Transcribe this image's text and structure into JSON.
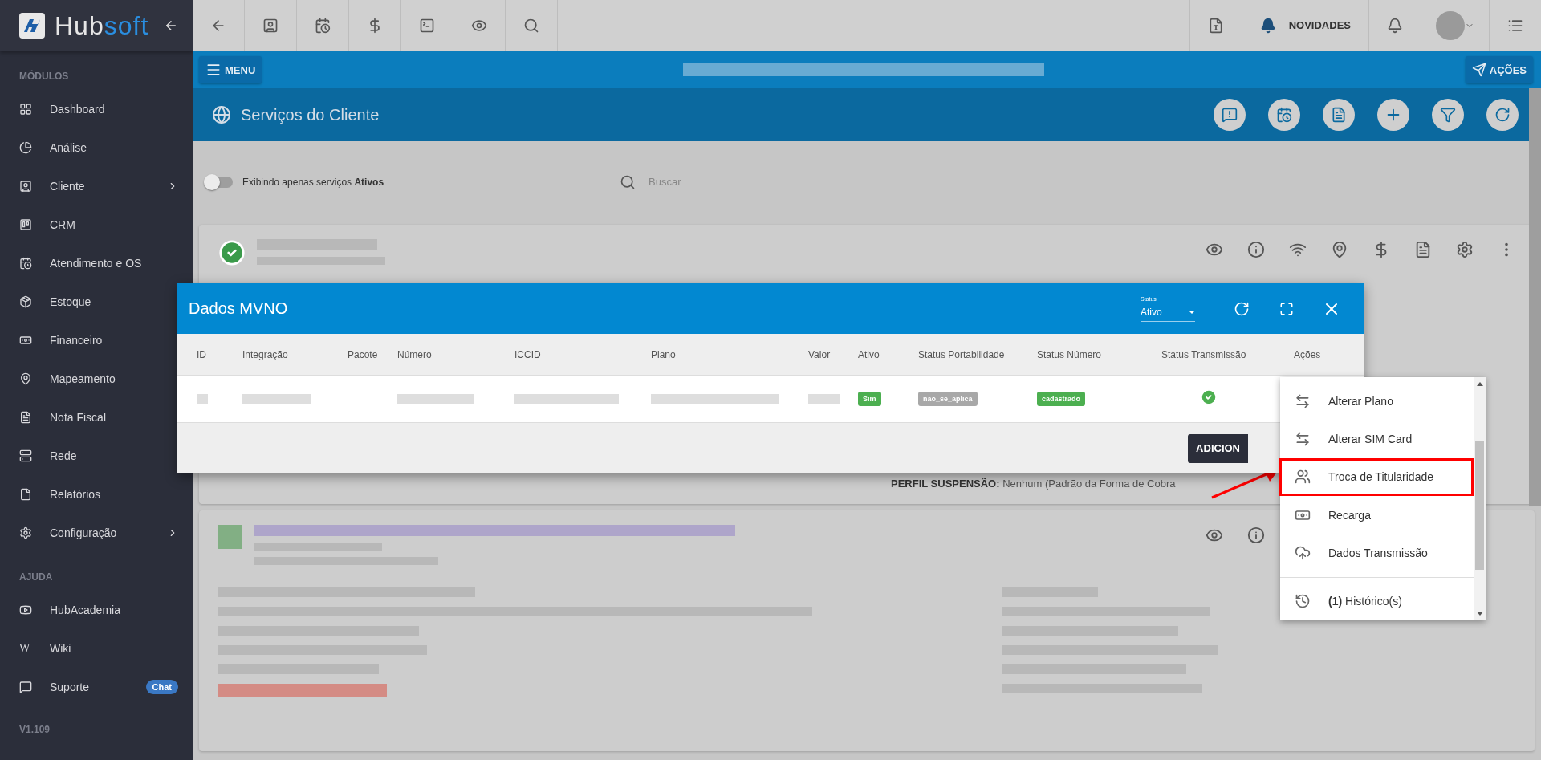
{
  "sidebar": {
    "logo": {
      "first": "Hub",
      "second": "soft"
    },
    "sections": [
      {
        "title": "MÓDULOS",
        "items": [
          {
            "label": "Dashboard",
            "submenu": false
          },
          {
            "label": "Análise",
            "submenu": false
          },
          {
            "label": "Cliente",
            "submenu": true
          },
          {
            "label": "CRM",
            "submenu": false
          },
          {
            "label": "Atendimento e OS",
            "submenu": false
          },
          {
            "label": "Estoque",
            "submenu": false
          },
          {
            "label": "Financeiro",
            "submenu": false
          },
          {
            "label": "Mapeamento",
            "submenu": false
          },
          {
            "label": "Nota Fiscal",
            "submenu": false
          },
          {
            "label": "Rede",
            "submenu": false
          },
          {
            "label": "Relatórios",
            "submenu": false
          },
          {
            "label": "Configuração",
            "submenu": true
          }
        ]
      },
      {
        "title": "AJUDA",
        "items": [
          {
            "label": "HubAcademia",
            "submenu": false
          },
          {
            "label": "Wiki",
            "submenu": false,
            "glyph": "W"
          },
          {
            "label": "Suporte",
            "submenu": false,
            "badge": "Chat"
          }
        ]
      }
    ],
    "version": "V1.109"
  },
  "topbar": {
    "news": "NOVIDADES"
  },
  "nav_bar": {
    "menu_button": "MENU",
    "actions_button": "AÇÕES"
  },
  "page_title": "Serviços do Cliente",
  "filter": {
    "toggle": {
      "label": "Exibindo apenas serviços **Ativos**",
      "on": false
    },
    "search": {
      "placeholder": "Buscar"
    }
  },
  "card": {
    "field_label": "PERFIL SUSPENSÃO:",
    "field_value": "Nenhum (Padrão da Forma de Cobra"
  },
  "modal": {
    "title": "Dados MVNO",
    "status_select": {
      "label": "Status",
      "value": "Ativo"
    },
    "columns": [
      "ID",
      "Integração",
      "Pacote",
      "Número",
      "ICCID",
      "Plano",
      "Valor",
      "Ativo",
      "Status Portabilidade",
      "Status Número",
      "Status Transmissão",
      "Ações"
    ],
    "rows": [
      {
        "ativo": "Sim",
        "status_portabilidade": "nao_se_aplica",
        "status_numero": "cadastrado",
        "transmitted": true
      }
    ],
    "footer_button": "ADICION"
  },
  "actions_menu": {
    "items": [
      {
        "label": "Alterar Plano",
        "highlighted": false
      },
      {
        "label": "Alterar SIM Card",
        "highlighted": false
      },
      {
        "label": "Troca de Titularidade",
        "highlighted": true
      },
      {
        "label": "Recarga",
        "highlighted": false
      },
      {
        "label": "Dados Transmissão",
        "highlighted": false
      }
    ],
    "history": {
      "label": "**(1)** Histórico(s)"
    }
  }
}
